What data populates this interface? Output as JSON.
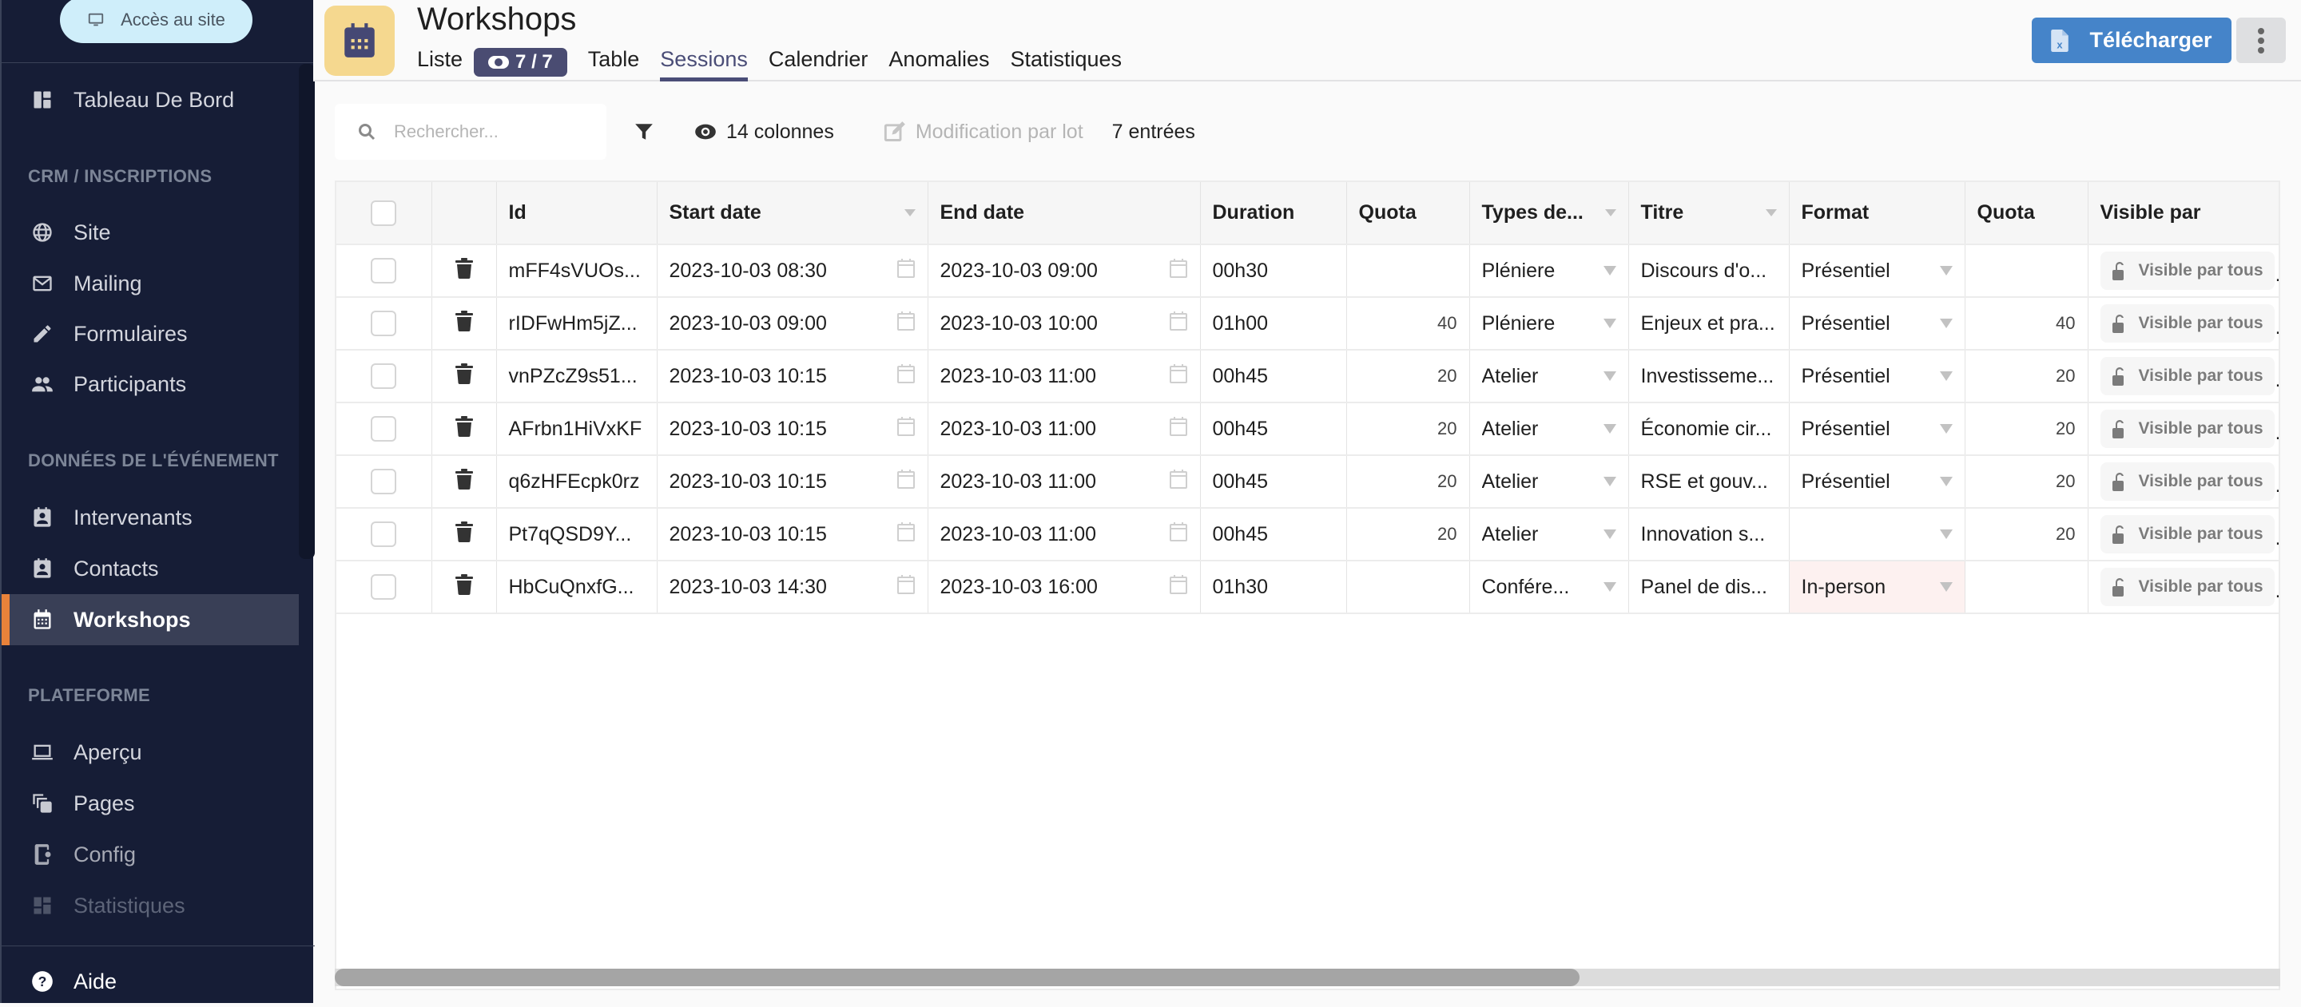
{
  "sidebar": {
    "site_button": "Accès au site",
    "dashboard": "Tableau De Bord",
    "sections": [
      {
        "title": "CRM / INSCRIPTIONS",
        "items": [
          {
            "label": "Site",
            "icon": "globe-icon"
          },
          {
            "label": "Mailing",
            "icon": "mail-icon"
          },
          {
            "label": "Formulaires",
            "icon": "pencil-icon"
          },
          {
            "label": "Participants",
            "icon": "people-icon"
          }
        ]
      },
      {
        "title": "DONNÉES DE L'ÉVÉNEMENT",
        "items": [
          {
            "label": "Intervenants",
            "icon": "contact-card-icon"
          },
          {
            "label": "Contacts",
            "icon": "contact-card-icon"
          },
          {
            "label": "Workshops",
            "icon": "calendar-icon",
            "active": true
          }
        ]
      },
      {
        "title": "PLATEFORME",
        "items": [
          {
            "label": "Aperçu",
            "icon": "laptop-icon"
          },
          {
            "label": "Pages",
            "icon": "pages-icon"
          },
          {
            "label": "Config",
            "icon": "device-settings-icon"
          },
          {
            "label": "Statistiques",
            "icon": "dashboard-icon",
            "disabled": true
          }
        ]
      }
    ],
    "help": "Aide"
  },
  "header": {
    "title": "Workshops",
    "tabs": [
      {
        "label": "Liste"
      },
      {
        "label": "Table"
      },
      {
        "label": "Sessions",
        "active": true
      },
      {
        "label": "Calendrier"
      },
      {
        "label": "Anomalies"
      },
      {
        "label": "Statistiques"
      }
    ],
    "count_badge": "7 / 7",
    "download_label": "Télécharger",
    "accent_color": "#4584c9"
  },
  "toolbar": {
    "search_placeholder": "Rechercher...",
    "search_value": "",
    "columns_label": "14 colonnes",
    "bulk_edit_label": "Modification par lot",
    "entries_label": "7 entrées"
  },
  "table": {
    "columns": [
      "Id",
      "Start date",
      "End date",
      "Duration",
      "Quota",
      "Types de...",
      "Titre",
      "Format",
      "Quota",
      "Visible par"
    ],
    "rows": [
      {
        "id": "mFF4sVUOs...",
        "start": "2023-10-03 08:30",
        "end": "2023-10-03 09:00",
        "duration": "00h30",
        "quota": "",
        "type": "Pléniere",
        "title": "Discours d'o...",
        "format": "Présentiel",
        "quota2": "",
        "visible": "Visible par tous"
      },
      {
        "id": "rIDFwHm5jZ...",
        "start": "2023-10-03 09:00",
        "end": "2023-10-03 10:00",
        "duration": "01h00",
        "quota": "40",
        "type": "Pléniere",
        "title": "Enjeux et pra...",
        "format": "Présentiel",
        "quota2": "40",
        "visible": "Visible par tous"
      },
      {
        "id": "vnPZcZ9s51...",
        "start": "2023-10-03 10:15",
        "end": "2023-10-03 11:00",
        "duration": "00h45",
        "quota": "20",
        "type": "Atelier",
        "title": "Investisseme...",
        "format": "Présentiel",
        "quota2": "20",
        "visible": "Visible par tous"
      },
      {
        "id": "AFrbn1HiVxKF",
        "start": "2023-10-03 10:15",
        "end": "2023-10-03 11:00",
        "duration": "00h45",
        "quota": "20",
        "type": "Atelier",
        "title": "Économie cir...",
        "format": "Présentiel",
        "quota2": "20",
        "visible": "Visible par tous"
      },
      {
        "id": "q6zHFEcpk0rz",
        "start": "2023-10-03 10:15",
        "end": "2023-10-03 11:00",
        "duration": "00h45",
        "quota": "20",
        "type": "Atelier",
        "title": "RSE et gouv...",
        "format": "Présentiel",
        "quota2": "20",
        "visible": "Visible par tous"
      },
      {
        "id": "Pt7qQSD9Y...",
        "start": "2023-10-03 10:15",
        "end": "2023-10-03 11:00",
        "duration": "00h45",
        "quota": "20",
        "type": "Atelier",
        "title": "Innovation s...",
        "format": "",
        "quota2": "20",
        "visible": "Visible par tous"
      },
      {
        "id": "HbCuQnxfG...",
        "start": "2023-10-03 14:30",
        "end": "2023-10-03 16:00",
        "duration": "01h30",
        "quota": "",
        "type": "Confére...",
        "title": "Panel de dis...",
        "format": "In-person",
        "format_invalid": true,
        "quota2": "",
        "visible": "Visible par tous"
      }
    ],
    "horizontal_scroll_fraction_visible": 0.64
  }
}
